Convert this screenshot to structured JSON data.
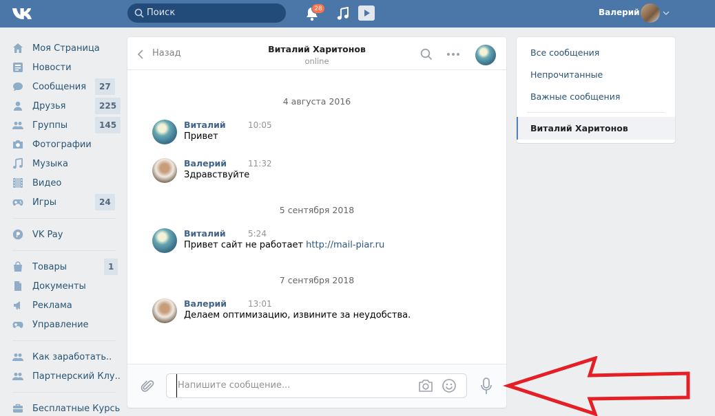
{
  "header": {
    "search_placeholder": "Поиск",
    "notifications_count": "28",
    "user_name": "Валерий"
  },
  "sidebar": {
    "items": [
      {
        "label": "Моя Страница",
        "icon": "home-icon"
      },
      {
        "label": "Новости",
        "icon": "news-icon"
      },
      {
        "label": "Сообщения",
        "icon": "messages-icon",
        "count": "27"
      },
      {
        "label": "Друзья",
        "icon": "friends-icon",
        "count": "225"
      },
      {
        "label": "Группы",
        "icon": "groups-icon",
        "count": "145"
      },
      {
        "label": "Фотографии",
        "icon": "camera-icon"
      },
      {
        "label": "Музыка",
        "icon": "music-icon"
      },
      {
        "label": "Видео",
        "icon": "video-icon"
      },
      {
        "label": "Игры",
        "icon": "games-icon",
        "count": "24"
      },
      {
        "label": "VK Pay",
        "icon": "vkpay-icon"
      },
      {
        "label": "Товары",
        "icon": "shopping-bag-icon",
        "count": "1"
      },
      {
        "label": "Документы",
        "icon": "document-icon"
      },
      {
        "label": "Реклама",
        "icon": "megaphone-icon"
      },
      {
        "label": "Управление",
        "icon": "gamepad-icon"
      },
      {
        "label": "Как заработать..",
        "icon": "group-icon"
      },
      {
        "label": "Партнерский Клу..",
        "icon": "group-icon"
      },
      {
        "label": "Бесплатные Курсы",
        "icon": "briefcase-icon"
      }
    ]
  },
  "chat": {
    "back_label": "Назад",
    "peer_name": "Виталий Харитонов",
    "peer_status": "online",
    "dates": [
      "4 августа 2016",
      "5 сентября 2018",
      "7 сентября 2018"
    ],
    "messages": [
      {
        "author": "Виталий",
        "time": "10:05",
        "text": "Привет"
      },
      {
        "author": "Валерий",
        "time": "11:32",
        "text": "Здравствуйте"
      },
      {
        "author": "Виталий",
        "time": "5:24",
        "text": "Привет сайт не работает ",
        "link": "http://mail-piar.ru"
      },
      {
        "author": "Валерий",
        "time": "13:01",
        "text": "Делаем оптимизацию, извините за неудобства."
      }
    ],
    "composer_placeholder": "Напишите сообщение..."
  },
  "right_panel": {
    "items": [
      "Все сообщения",
      "Непрочитанные",
      "Важные сообщения"
    ],
    "active": "Виталий Харитонов"
  },
  "colors": {
    "header_bg": "#4a76a8",
    "accent": "#5181b8",
    "annotation_arrow": "#e41f26"
  }
}
